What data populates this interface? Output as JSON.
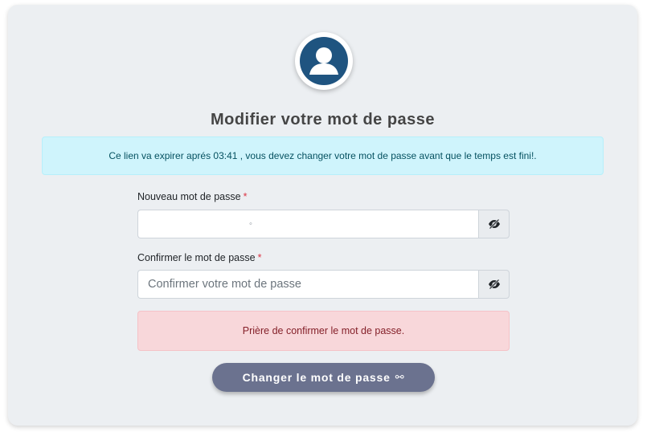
{
  "form": {
    "title": "Modifier votre mot de passe",
    "info_message": "Ce lien va expirer aprés 03:41 , vous devez changer votre mot de passe avant que le temps est fini!.",
    "new_password": {
      "label": "Nouveau mot de passe",
      "required_mark": "*",
      "value": "◦"
    },
    "confirm_password": {
      "label": "Confirmer le mot de passe",
      "required_mark": "*",
      "placeholder": "Confirmer votre mot de passe"
    },
    "error_message": "Prière de confirmer le mot de passe.",
    "submit_label": "Changer le mot de passe",
    "submit_icon": "⚯"
  },
  "icons": {
    "avatar": "user-avatar-icon",
    "toggle_visibility": "eye-slash-icon",
    "submit": "key-icon"
  },
  "colors": {
    "avatar_bg": "#1f5480",
    "info_bg": "#cff4fc",
    "danger_bg": "#f8d7da",
    "button_bg": "#6b728f",
    "card_bg": "#eceff2"
  }
}
